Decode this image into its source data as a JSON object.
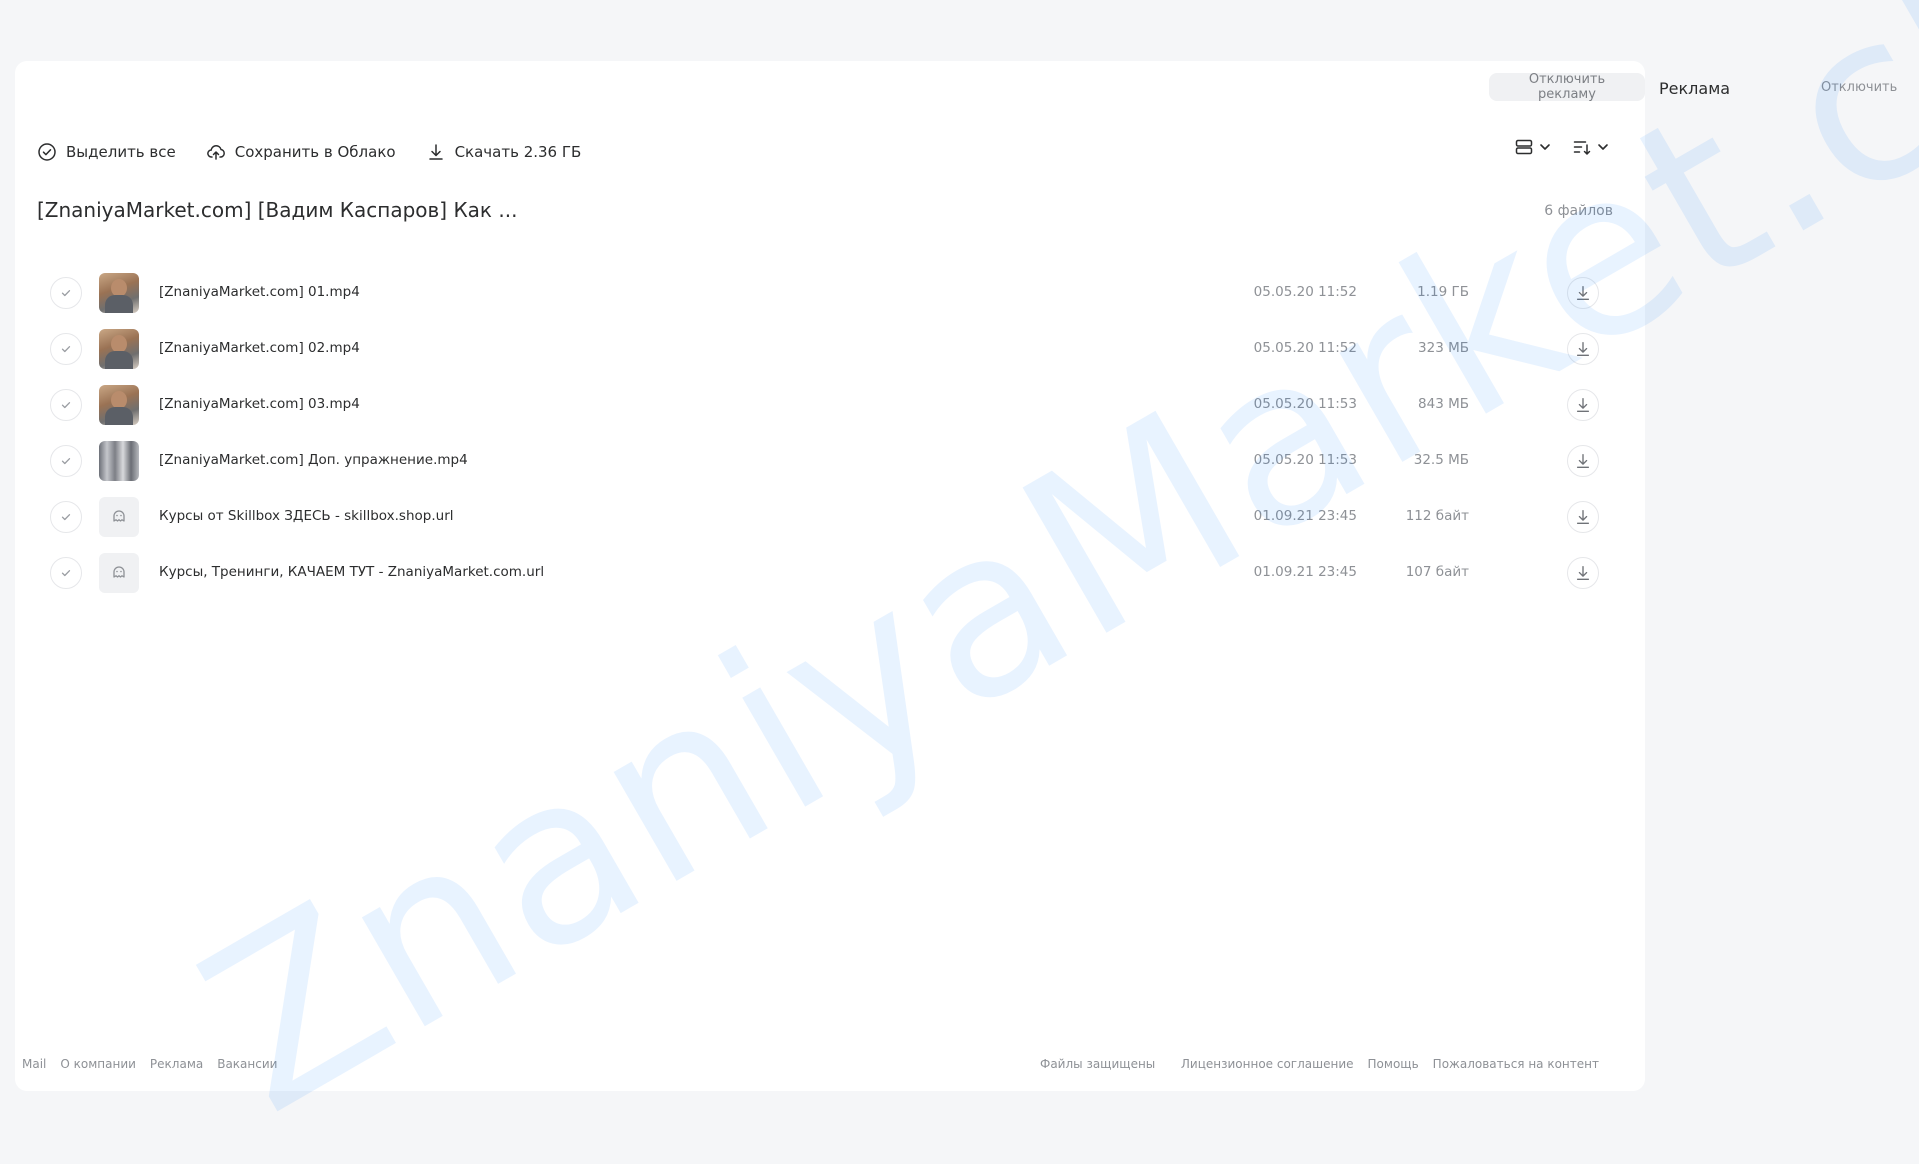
{
  "toolbar": {
    "disable_ads_label": "Отключить рекламу",
    "select_all_label": "Выделить все",
    "save_to_cloud_label": "Сохранить в Облако",
    "download_label": "Скачать 2.36 ГБ"
  },
  "folder": {
    "title": "[ZnaniyaMarket.com] [Вадим Каспаров] Как ...",
    "file_count": "6 файлов"
  },
  "files": [
    {
      "name": "[ZnaniyaMarket.com] 01.mp4",
      "date": "05.05.20 11:52",
      "size": "1.19 ГБ",
      "thumb": "video"
    },
    {
      "name": "[ZnaniyaMarket.com] 02.mp4",
      "date": "05.05.20 11:52",
      "size": "323 МБ",
      "thumb": "video"
    },
    {
      "name": "[ZnaniyaMarket.com] 03.mp4",
      "date": "05.05.20 11:53",
      "size": "843 МБ",
      "thumb": "video"
    },
    {
      "name": "[ZnaniyaMarket.com] Доп. упражнение.mp4",
      "date": "05.05.20 11:53",
      "size": "32.5 МБ",
      "thumb": "video-blur"
    },
    {
      "name": "Курсы от Skillbox ЗДЕСЬ - skillbox.shop.url",
      "date": "01.09.21 23:45",
      "size": "112 байт",
      "thumb": "url-icon"
    },
    {
      "name": "Курсы, Тренинги, КАЧАЕМ ТУТ - ZnaniyaMarket.com.url",
      "date": "01.09.21 23:45",
      "size": "107 байт",
      "thumb": "url-icon"
    }
  ],
  "ads": {
    "title": "Реклама",
    "disable_label": "Отключить"
  },
  "footer": {
    "left_links": [
      "Mail",
      "О компании",
      "Реклама",
      "Вакансии"
    ],
    "center_text": "Файлы защищены",
    "right_links": [
      "Лицензионное соглашение",
      "Помощь",
      "Пожаловаться на контент"
    ]
  },
  "watermark": "ZnaniyaMarket.club",
  "colors": {
    "background": "#f5f6f8",
    "panel": "#ffffff",
    "text": "#2c2d2e",
    "muted": "#8e9196",
    "watermark": "#0077ff"
  }
}
